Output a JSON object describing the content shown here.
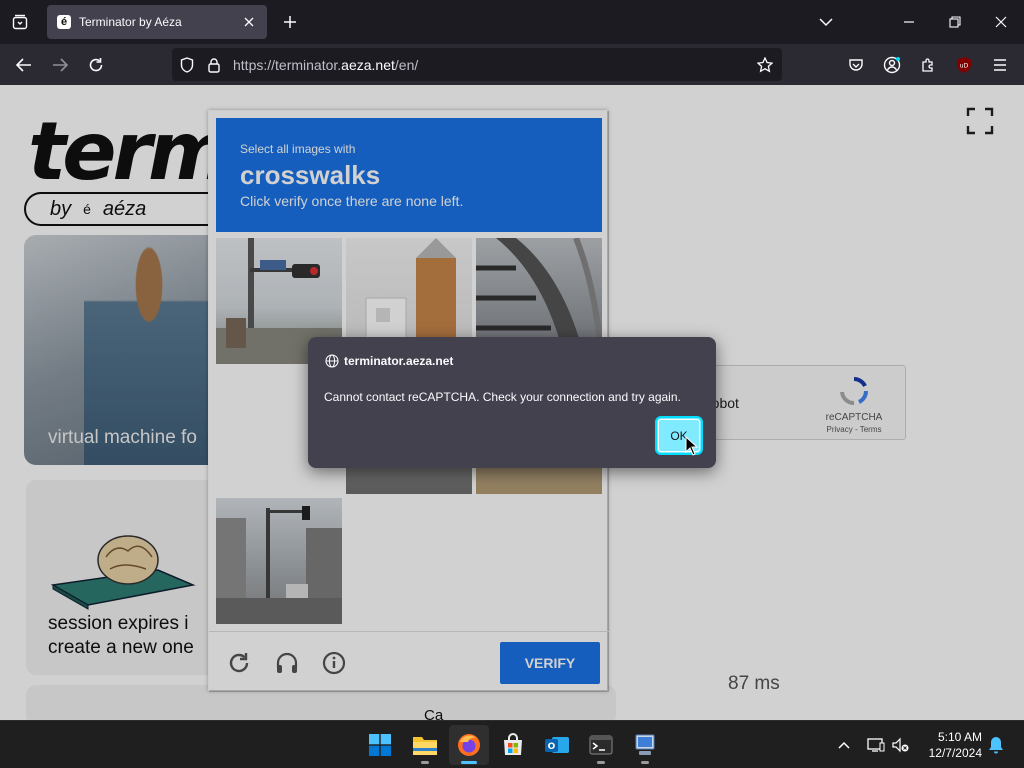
{
  "browser": {
    "tab": {
      "favicon_glyph": "é",
      "title": "Terminator by Aéza"
    },
    "url": {
      "prefix": "https://terminator.",
      "host": "aeza.net",
      "suffix": "/en/"
    }
  },
  "page": {
    "logo_text": "term",
    "byline": {
      "by": "by",
      "mark": "é",
      "brand": "aéza"
    },
    "hero_caption": "virtual machine fo",
    "session_text": {
      "line1": "session expires i",
      "line2": "create a new one"
    },
    "bottom_card_text": "Ca",
    "recaptcha_checkbox": {
      "label": "robot",
      "brand": "reCAPTCHA",
      "links": "Privacy - Terms"
    },
    "latency": "87 ms"
  },
  "captcha": {
    "instruction": "Select all images with",
    "target": "crosswalks",
    "hint": "Click verify once there are none left.",
    "verify_label": "VERIFY",
    "tiles": [
      "traffic-light-tile",
      "building-stairs-tile",
      "escalator-tile",
      "empty-tile",
      "street-tile",
      "pavement-tile",
      "intersection-tile"
    ]
  },
  "dialog": {
    "origin": "terminator.aeza.net",
    "message": "Cannot contact reCAPTCHA. Check your connection and try again.",
    "ok_label": "OK"
  },
  "taskbar": {
    "time": "5:10 AM",
    "date": "12/7/2024",
    "apps": [
      "start",
      "file-explorer",
      "firefox",
      "microsoft-store",
      "outlook",
      "terminal",
      "remote-desktop"
    ]
  },
  "colors": {
    "accent_blue": "#1a73e8",
    "ok_button": "#80ebff",
    "taskbar_active": "#4cc2ff",
    "dialog_bg": "#42414d"
  }
}
